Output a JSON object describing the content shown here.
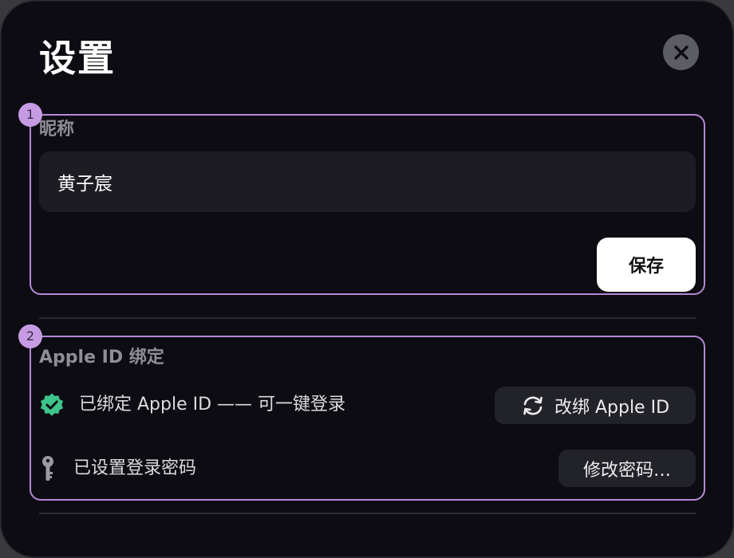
{
  "window": {
    "title": "设置"
  },
  "icons": {
    "close": "close-icon",
    "verified": "verified-check-icon",
    "key": "key-icon",
    "sync": "sync-icon"
  },
  "colors": {
    "background": "#0c0c12",
    "field": "#1c1c22",
    "highlight_border": "#b488d6",
    "badge": "#c79be3",
    "verified_green": "#3ec48a",
    "primary_button": "#ffffff"
  },
  "sections": [
    {
      "badge": "1",
      "label": "昵称",
      "input_value": "黄子宸",
      "save_label": "保存"
    },
    {
      "badge": "2",
      "label": "Apple ID 绑定",
      "bound_status": "已绑定 Apple ID —— 可一键登录",
      "rebind_label": "改绑 Apple ID",
      "password_status": "已设置登录密码",
      "change_password_label": "修改密码…"
    }
  ]
}
